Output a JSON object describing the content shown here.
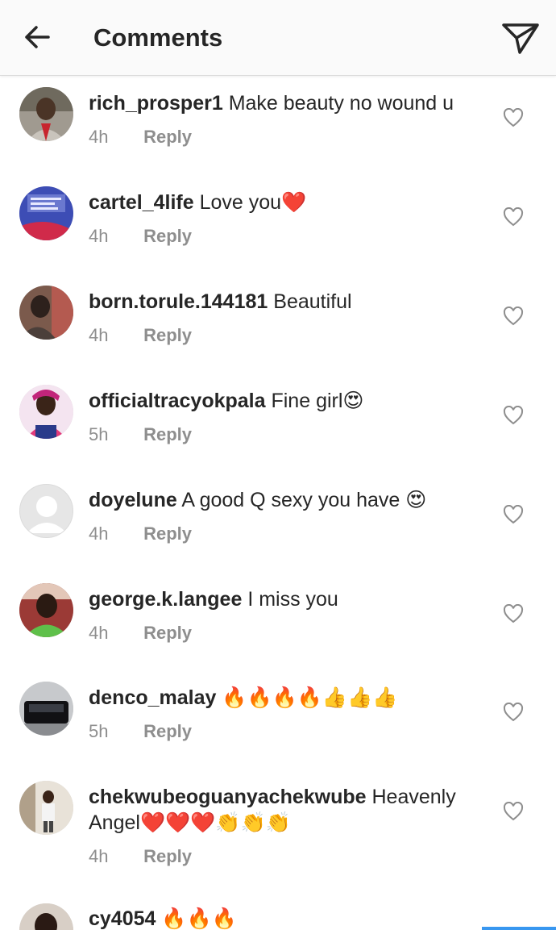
{
  "header": {
    "title": "Comments"
  },
  "comments": [
    {
      "username": "rich_prosper1",
      "text": "Make beauty no wound u",
      "time": "4h",
      "reply": "Reply",
      "avatar_color": "#7a6a55"
    },
    {
      "username": "cartel_4life",
      "text": "Love you",
      "emoji": "❤️",
      "time": "4h",
      "reply": "Reply",
      "avatar_color": "#3f4fb0"
    },
    {
      "username": "born.torule.144181",
      "text": "Beautiful",
      "time": "4h",
      "reply": "Reply",
      "avatar_color": "#5a3d35"
    },
    {
      "username": "officialtracyokpala",
      "text": "Fine girl",
      "emoji": "😍",
      "time": "5h",
      "reply": "Reply",
      "avatar_color": "#c83a9a"
    },
    {
      "username": "doyelune",
      "text": "A good Q sexy you have",
      "emoji": "😍",
      "time": "4h",
      "reply": "Reply",
      "avatar_color": "#dbdbdb"
    },
    {
      "username": "george.k.langee",
      "text": "I miss you",
      "time": "4h",
      "reply": "Reply",
      "avatar_color": "#5a8a3a"
    },
    {
      "username": "denco_malay",
      "text": "",
      "emoji": "🔥🔥🔥🔥👍👍👍",
      "time": "5h",
      "reply": "Reply",
      "avatar_color": "#1e1e24"
    },
    {
      "username": "chekwubeoguanyachekwube",
      "text": "Heavenly Angel",
      "emoji": "❤️❤️❤️👏👏👏",
      "time": "4h",
      "reply": "Reply",
      "avatar_color": "#8a7a66"
    },
    {
      "username": "cy4054",
      "text": "",
      "emoji": "🔥🔥🔥",
      "time": "",
      "reply": "",
      "avatar_color": "#3a2a25"
    }
  ]
}
